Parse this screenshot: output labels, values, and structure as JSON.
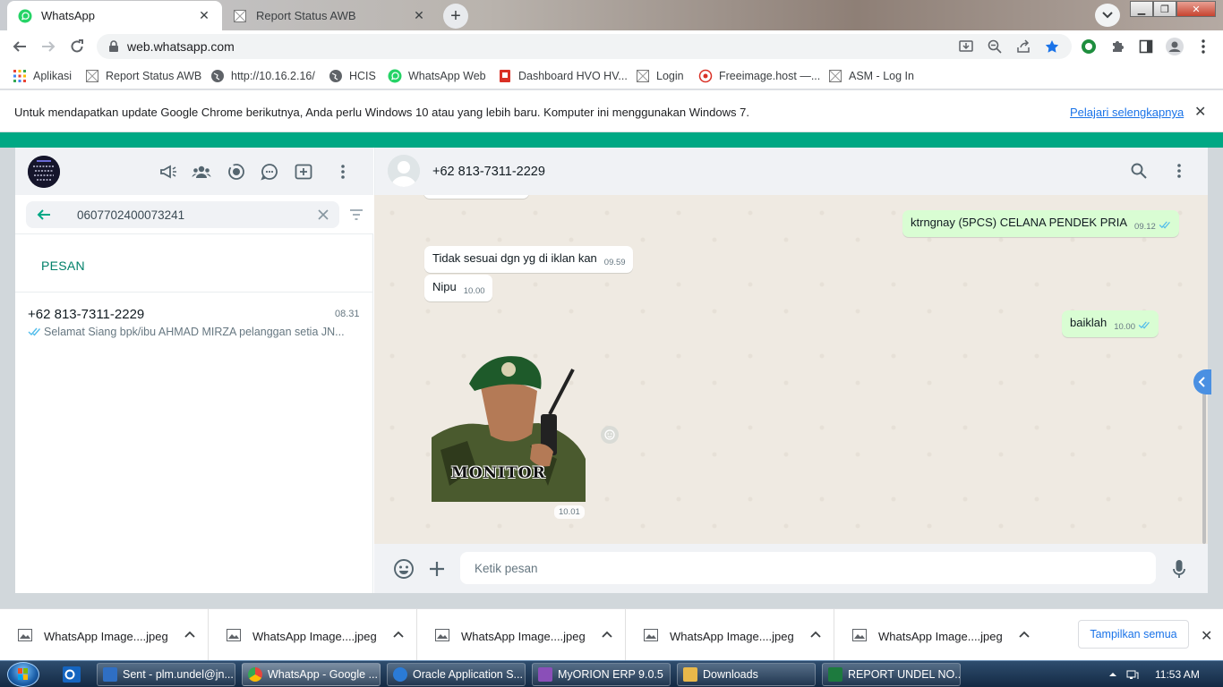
{
  "browser": {
    "tabs": [
      {
        "title": "WhatsApp",
        "active": true,
        "icon": "whatsapp-icon"
      },
      {
        "title": "Report Status AWB",
        "active": false,
        "icon": "page-icon"
      }
    ],
    "url": "web.whatsapp.com",
    "bookmarks": [
      {
        "label": "Aplikasi",
        "icon": "apps-grid-icon"
      },
      {
        "label": "Report Status AWB",
        "icon": "page-icon"
      },
      {
        "label": "http://10.16.2.16/",
        "icon": "globe-icon"
      },
      {
        "label": "HCIS",
        "icon": "globe-icon"
      },
      {
        "label": "WhatsApp Web",
        "icon": "whatsapp-icon"
      },
      {
        "label": "Dashboard HVO HV...",
        "icon": "dashboard-icon"
      },
      {
        "label": "Login",
        "icon": "page-icon"
      },
      {
        "label": "Freeimage.host —...",
        "icon": "freeimage-icon"
      },
      {
        "label": "ASM - Log In",
        "icon": "page-icon"
      }
    ],
    "infobar": {
      "message": "Untuk mendapatkan update Google Chrome berikutnya, Anda perlu Windows 10 atau yang lebih baru. Komputer ini menggunakan Windows 7.",
      "link": "Pelajari selengkapnya"
    }
  },
  "sidebar": {
    "search_value": "0607702400073241",
    "section_label": "PESAN",
    "results": [
      {
        "name": "+62 813-7311-2229",
        "time": "08.31",
        "preview": "Selamat Siang   bpk/ibu AHMAD MIRZA pelanggan setia JN..."
      }
    ]
  },
  "conversation": {
    "contact": "+62 813-7311-2229",
    "messages": [
      {
        "dir": "out",
        "text": "ktrngnay (5PCS) CELANA PENDEK PRIA",
        "time": "09.12"
      },
      {
        "dir": "in",
        "text": "Tidak sesuai dgn yg di iklan kan",
        "time": "09.59"
      },
      {
        "dir": "in",
        "text": "Nipu",
        "time": "10.00"
      },
      {
        "dir": "out",
        "text": "baiklah",
        "time": "10.00"
      }
    ],
    "sticker": {
      "caption": "MONITOR",
      "time": "10.01"
    },
    "composer_placeholder": "Ketik pesan"
  },
  "downloads": {
    "items": [
      "WhatsApp Image....jpeg",
      "WhatsApp Image....jpeg",
      "WhatsApp Image....jpeg",
      "WhatsApp Image....jpeg",
      "WhatsApp Image....jpeg"
    ],
    "show_all": "Tampilkan semua"
  },
  "taskbar": {
    "items": [
      {
        "label": "Sent - plm.undel@jn...",
        "color": "#2f6fc4"
      },
      {
        "label": "WhatsApp - Google ...",
        "color": "#e8453c"
      },
      {
        "label": "Oracle Application S...",
        "color": "#2b7bd6"
      },
      {
        "label": "MyORION ERP 9.0.5",
        "color": "#8a4fb8"
      },
      {
        "label": "Downloads",
        "color": "#e8b84a"
      },
      {
        "label": "REPORT UNDEL NO...",
        "color": "#1d7a3e"
      }
    ],
    "clock": "11:53 AM"
  },
  "colors": {
    "wa_green": "#00a884",
    "outgoing_bubble": "#d9fdd3",
    "chat_bg": "#efeae2",
    "tick_blue": "#53bdeb"
  }
}
